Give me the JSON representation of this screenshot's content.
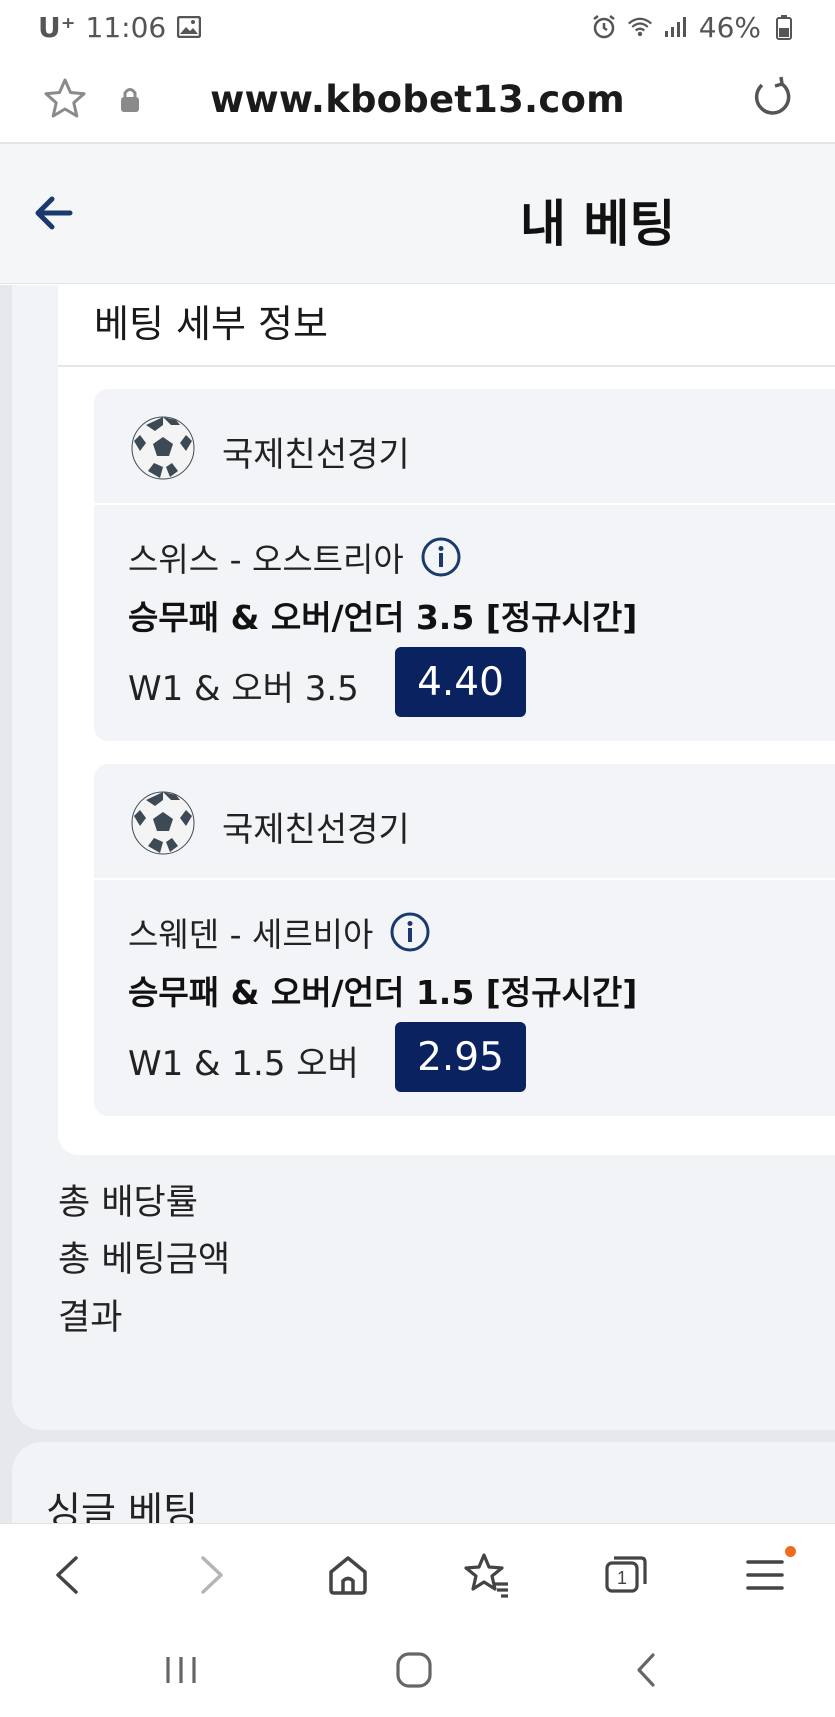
{
  "status_bar": {
    "carrier": "U⁺",
    "time": "11:06",
    "battery": "46%",
    "icons": [
      "image-icon",
      "alarm-icon",
      "wifi-icon",
      "signal-icon",
      "battery-icon"
    ]
  },
  "browser": {
    "url": "www.kbobet13.com",
    "icons": [
      "star-icon",
      "lock-icon",
      "reload-icon"
    ]
  },
  "header": {
    "title": "내 베팅",
    "back_icon": "back-arrow-icon"
  },
  "bet_details": {
    "title": "베팅 세부 정보",
    "bets": [
      {
        "league": "국제친선경기",
        "match": "스위스 - 오스트리아",
        "market": "승무패 & 오버/언더 3.5 [정규시간]",
        "selection": "W1 & 오버 3.5",
        "odds": "4.40"
      },
      {
        "league": "국제친선경기",
        "match": "스웨덴 - 세르비아",
        "market": "승무패 & 오버/언더 1.5 [정규시간]",
        "selection": "W1 & 1.5 오버",
        "odds": "2.95"
      }
    ]
  },
  "summary": {
    "total_odds_label": "총 배당률",
    "total_stake_label": "총 베팅금액",
    "result_label": "결과"
  },
  "single_bet": {
    "title": "싱글 베팅"
  },
  "toolbar": {
    "tabs_count": "1",
    "icons": [
      "back-icon",
      "forward-icon",
      "home-icon",
      "bookmarks-icon",
      "tabs-icon",
      "menu-icon"
    ]
  },
  "colors": {
    "odds_bg": "#0b2260",
    "accent_navy": "#1a3a6e",
    "menu_dot": "#f26b1d"
  }
}
